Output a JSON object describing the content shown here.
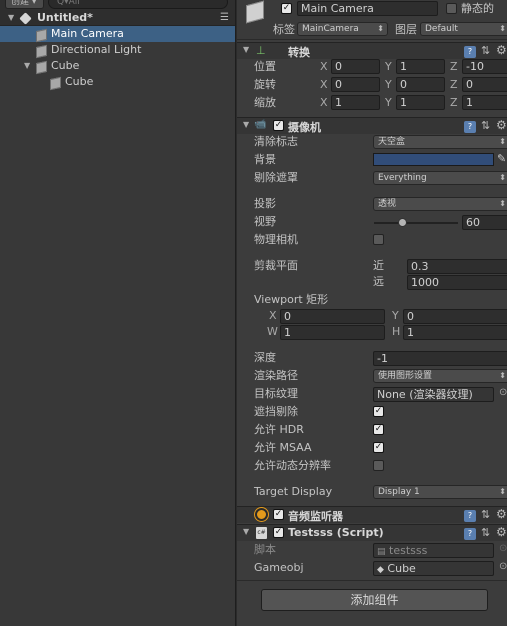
{
  "hierarchy": {
    "create_label": "创建 ▾",
    "search_placeholder": "Q▾All",
    "scene_name": "Untitled*",
    "items": [
      {
        "label": "Main Camera"
      },
      {
        "label": "Directional Light"
      },
      {
        "label": "Cube"
      },
      {
        "label": "Cube"
      }
    ]
  },
  "inspector": {
    "object_name": "Main Camera",
    "static_label": "静态的",
    "tag_label": "标签",
    "tag_value": "MainCamera",
    "layer_label": "图层",
    "layer_value": "Default",
    "transform": {
      "title": "转换",
      "rows": [
        {
          "label": "位置",
          "x": "0",
          "y": "1",
          "z": "-10"
        },
        {
          "label": "旋转",
          "x": "0",
          "y": "0",
          "z": "0"
        },
        {
          "label": "缩放",
          "x": "1",
          "y": "1",
          "z": "1"
        }
      ],
      "axis_x": "X",
      "axis_y": "Y",
      "axis_z": "Z"
    },
    "camera": {
      "title": "摄像机",
      "clear_flags_label": "清除标志",
      "clear_flags_value": "天空盒",
      "background_label": "背景",
      "culling_mask_label": "剔除遮罩",
      "culling_mask_value": "Everything",
      "projection_label": "投影",
      "projection_value": "透视",
      "fov_label": "视野",
      "fov_value": "60",
      "fov_fraction": 0.33,
      "physical_label": "物理相机",
      "clipping_label": "剪裁平面",
      "near_label": "近",
      "near_value": "0.3",
      "far_label": "远",
      "far_value": "1000",
      "viewport_label": "Viewport 矩形",
      "vp_x_label": "X",
      "vp_x": "0",
      "vp_y_label": "Y",
      "vp_y": "0",
      "vp_w_label": "W",
      "vp_w": "1",
      "vp_h_label": "H",
      "vp_h": "1",
      "depth_label": "深度",
      "depth_value": "-1",
      "render_path_label": "渲染路径",
      "render_path_value": "使用图形设置",
      "target_texture_label": "目标纹理",
      "target_texture_value": "None (渲染器纹理)",
      "occlusion_label": "遮挡剔除",
      "hdr_label": "允许 HDR",
      "msaa_label": "允许 MSAA",
      "dynamic_res_label": "允许动态分辨率",
      "target_display_label": "Target Display",
      "target_display_value": "Display 1"
    },
    "audio_listener": {
      "title": "音频监听器"
    },
    "script_component": {
      "title": "Testsss (Script)",
      "script_label": "脚本",
      "script_value": "testsss",
      "gameobj_label": "Gameobj",
      "gameobj_value": "Cube"
    },
    "add_component_label": "添加组件"
  },
  "colors": {
    "selection": "#3d6185",
    "camera_background": "#314d79",
    "panel": "#383838"
  }
}
